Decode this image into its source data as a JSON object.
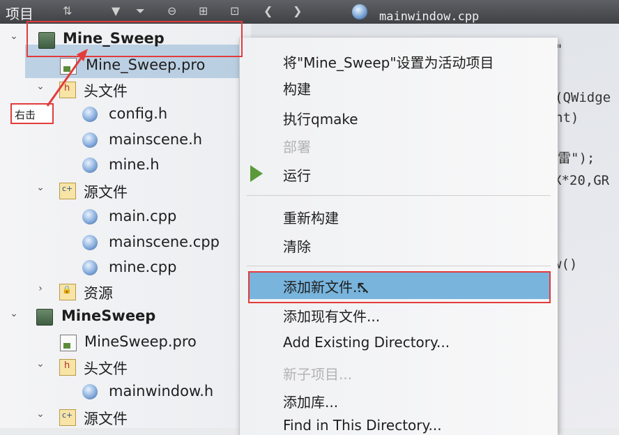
{
  "toolbar": {
    "title": "项目",
    "tab_label": "mainwindow.cpp"
  },
  "tree": {
    "items": [
      {
        "label": "Mine_Sweep",
        "icon": "qt-project-icon"
      },
      {
        "label": "Mine_Sweep.pro",
        "icon": "pro-file-icon"
      },
      {
        "label": "头文件",
        "icon": "header-folder-icon"
      },
      {
        "label": "config.h",
        "icon": "file-icon"
      },
      {
        "label": "mainscene.h",
        "icon": "file-icon"
      },
      {
        "label": "mine.h",
        "icon": "file-icon"
      },
      {
        "label": "源文件",
        "icon": "source-folder-icon"
      },
      {
        "label": "main.cpp",
        "icon": "file-icon"
      },
      {
        "label": "mainscene.cpp",
        "icon": "file-icon"
      },
      {
        "label": "mine.cpp",
        "icon": "file-icon"
      },
      {
        "label": "资源",
        "icon": "resource-folder-icon"
      },
      {
        "label": "MineSweep",
        "icon": "qt-project-icon"
      },
      {
        "label": "MineSweep.pro",
        "icon": "pro-file-icon"
      },
      {
        "label": "头文件",
        "icon": "header-folder-icon"
      },
      {
        "label": "mainwindow.h",
        "icon": "file-icon"
      },
      {
        "label": "源文件",
        "icon": "source-folder-icon"
      }
    ],
    "annotation": "右击"
  },
  "code": {
    "lines": [
      "\"",
      "(QWidge",
      "nt)",
      "雷\");",
      "X*20,GR",
      "w()"
    ]
  },
  "menu": {
    "items": [
      "将\"Mine_Sweep\"设置为活动项目",
      "构建",
      "执行qmake",
      "部署",
      "运行",
      "重新构建",
      "清除",
      "添加新文件...",
      "添加现有文件...",
      "Add Existing Directory...",
      "新子项目...",
      "添加库...",
      "Find in This Directory..."
    ]
  },
  "colors": {
    "highlight": "#78b4dc",
    "annotation_red": "#e33b3b"
  }
}
